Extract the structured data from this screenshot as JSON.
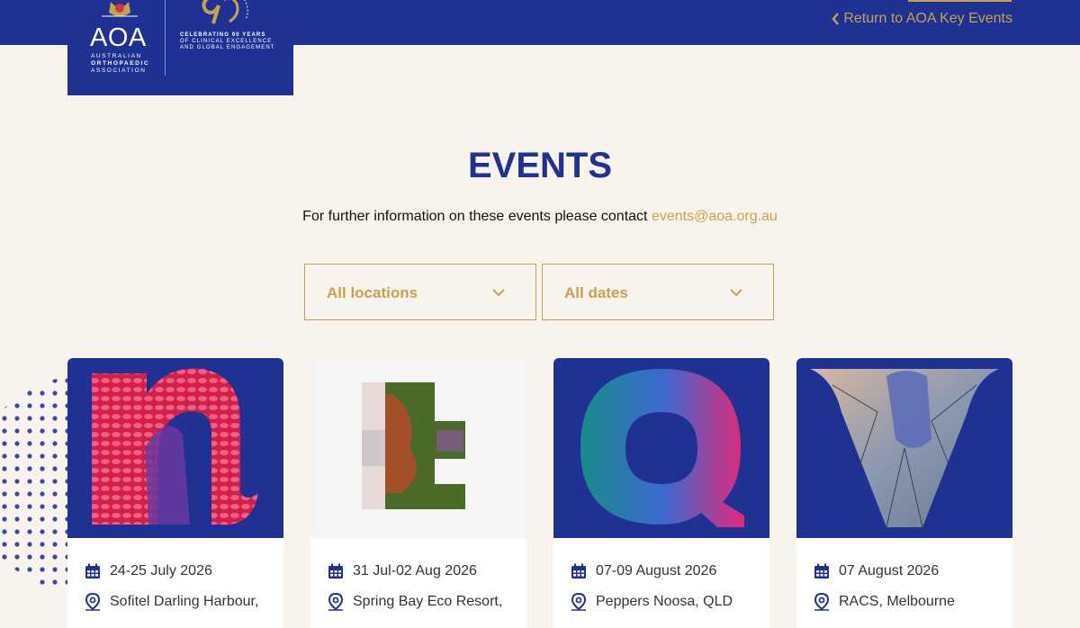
{
  "header": {
    "return_link": "Return to AOA Key Events"
  },
  "logo": {
    "abbr": "AOA",
    "line1": "AUSTRALIAN",
    "line2": "ORTHOPAEDIC",
    "line3": "ASSOCIATION",
    "anniv_1": "CELEBRATING 90 YEARS",
    "anniv_2": "OF CLINICAL EXCELLENCE",
    "anniv_3": "AND GLOBAL ENGAGEMENT"
  },
  "page": {
    "title": "EVENTS",
    "intro_text": "For further information on these events please contact ",
    "contact_email": "events@aoa.org.au"
  },
  "filters": {
    "location": "All locations",
    "date": "All dates"
  },
  "colors": {
    "navy": "#1f3192",
    "gold": "#c7a24e",
    "background": "#f8f3ec"
  },
  "cards": [
    {
      "date": "24-25 July 2026",
      "location": "Sofitel Darling Harbour,",
      "image_letter": "n"
    },
    {
      "date": "31 Jul-02 Aug 2026",
      "location": "Spring Bay Eco Resort,",
      "image_letter": "t"
    },
    {
      "date": "07-09 August 2026",
      "location": "Peppers Noosa, QLD",
      "image_letter": "Q"
    },
    {
      "date": "07 August 2026",
      "location": "RACS, Melbourne",
      "image_letter": "V"
    }
  ]
}
